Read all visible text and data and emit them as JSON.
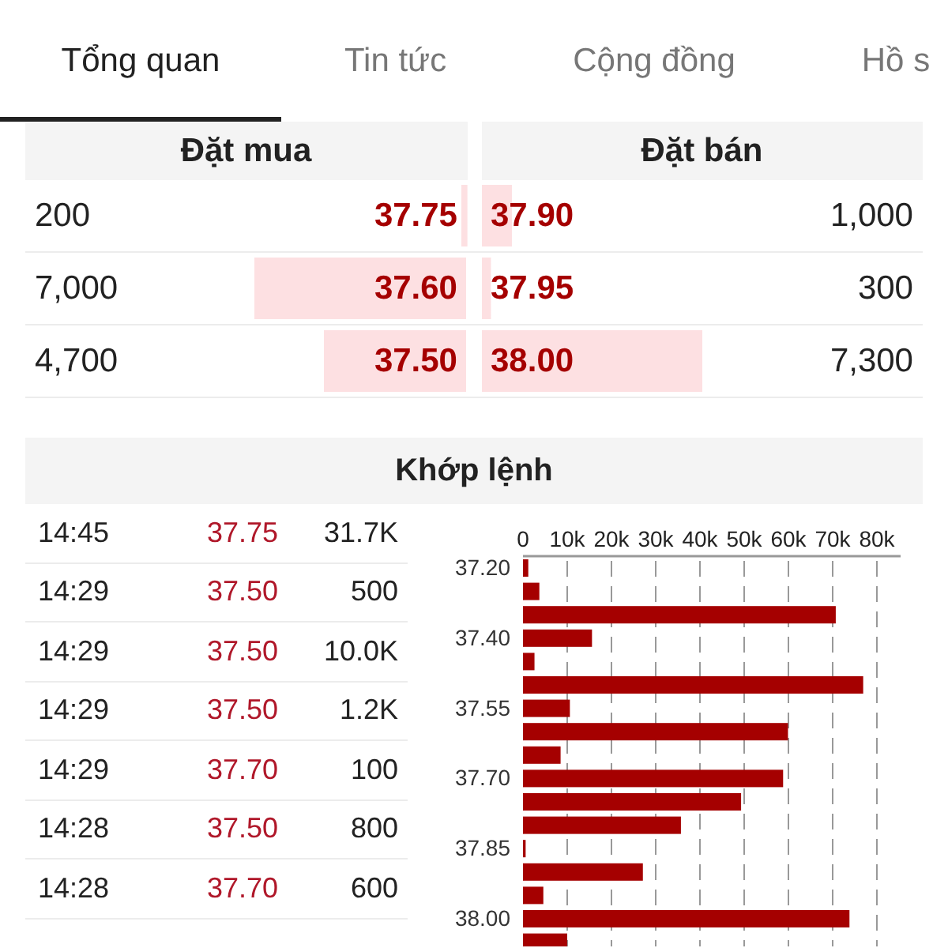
{
  "tabs": [
    {
      "label": "Tổng quan",
      "selected": true
    },
    {
      "label": "Tin tức",
      "selected": false
    },
    {
      "label": "Cộng đồng",
      "selected": false
    },
    {
      "label": "Hồ s",
      "selected": false
    }
  ],
  "order_book": {
    "bid_header": "Đặt mua",
    "ask_header": "Đặt bán",
    "rows": [
      {
        "bid": {
          "volume": "200",
          "price": "37.75"
        },
        "ask": {
          "price": "37.90",
          "volume": "1,000"
        }
      },
      {
        "bid": {
          "volume": "7,000",
          "price": "37.60"
        },
        "ask": {
          "price": "37.95",
          "volume": "300"
        }
      },
      {
        "bid": {
          "volume": "4,700",
          "price": "37.50"
        },
        "ask": {
          "price": "38.00",
          "volume": "7,300"
        }
      }
    ]
  },
  "matched": {
    "title": "Khớp lệnh",
    "price_labels": [
      "37.20",
      "37.40",
      "37.55",
      "37.70",
      "37.85",
      "38.00"
    ],
    "trades": [
      {
        "time": "14:45",
        "price": "37.75",
        "volume": "31.7K"
      },
      {
        "time": "14:29",
        "price": "37.50",
        "volume": "500"
      },
      {
        "time": "14:29",
        "price": "37.50",
        "volume": "10.0K"
      },
      {
        "time": "14:29",
        "price": "37.50",
        "volume": "1.2K"
      },
      {
        "time": "14:29",
        "price": "37.70",
        "volume": "100"
      },
      {
        "time": "14:28",
        "price": "37.50",
        "volume": "800"
      },
      {
        "time": "14:28",
        "price": "37.70",
        "volume": "600"
      }
    ],
    "chart_data": {
      "type": "bar",
      "orientation": "horizontal",
      "grid": true,
      "values": [
        1200,
        3700,
        70700,
        15600,
        2600,
        76900,
        10600,
        59900,
        8500,
        58800,
        49300,
        35700,
        600,
        27100,
        4600,
        73800,
        10000
      ],
      "xlim": [
        0,
        80000
      ],
      "xticks": [
        {
          "value": 0,
          "label": "0"
        },
        {
          "value": 10000,
          "label": "10k"
        },
        {
          "value": 20000,
          "label": "20k"
        },
        {
          "value": 30000,
          "label": "30k"
        },
        {
          "value": 40000,
          "label": "40k"
        },
        {
          "value": 50000,
          "label": "50k"
        },
        {
          "value": 60000,
          "label": "60k"
        },
        {
          "value": 70000,
          "label": "70k"
        },
        {
          "value": 80000,
          "label": "80k"
        }
      ]
    }
  }
}
